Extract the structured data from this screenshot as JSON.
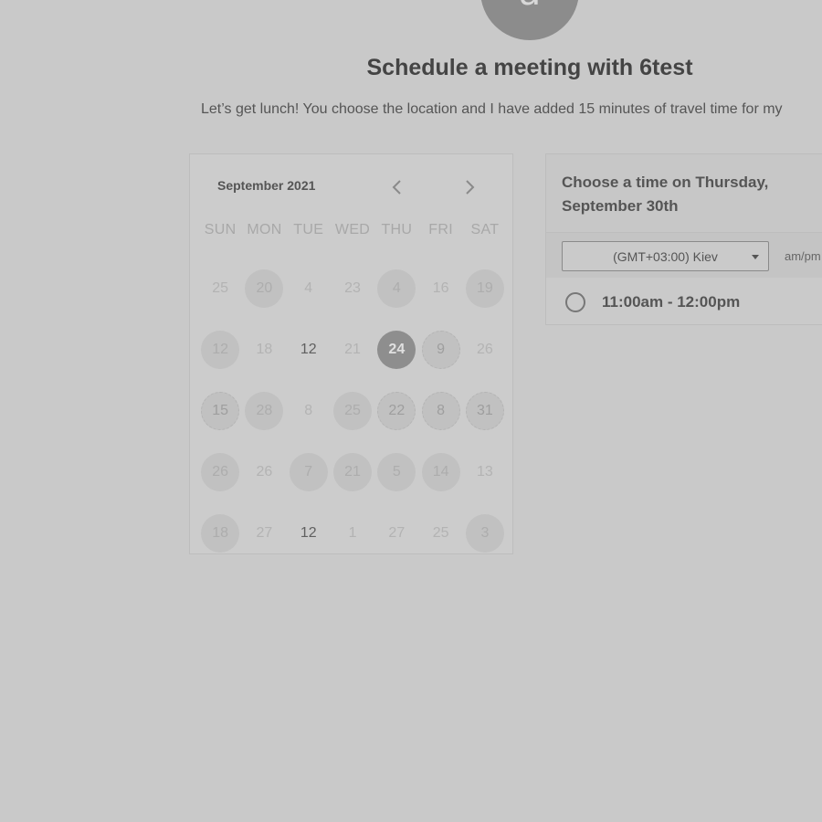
{
  "host": {
    "avatar_letter": "a",
    "title": "Schedule a meeting with 6test",
    "description": "Let’s get lunch! You choose the location and I have added 15 minutes of travel time for my"
  },
  "calendar": {
    "month_label": "September 2021",
    "prev_icon": "chevron-left-icon",
    "next_icon": "chevron-right-icon",
    "weekdays": [
      "SUN",
      "MON",
      "TUE",
      "WED",
      "THU",
      "FRI",
      "SAT"
    ],
    "weeks": [
      [
        {
          "d": "25",
          "s": "dim"
        },
        {
          "d": "20",
          "s": "avail"
        },
        {
          "d": "4",
          "s": "dim"
        },
        {
          "d": "23",
          "s": "dim"
        },
        {
          "d": "4",
          "s": "avail"
        },
        {
          "d": "16",
          "s": "dim"
        },
        {
          "d": "19",
          "s": "avail"
        }
      ],
      [
        {
          "d": "12",
          "s": "avail"
        },
        {
          "d": "18",
          "s": "dim"
        },
        {
          "d": "12",
          "s": "dark"
        },
        {
          "d": "21",
          "s": "dim"
        },
        {
          "d": "24",
          "s": "selected"
        },
        {
          "d": "9",
          "s": "dotted"
        },
        {
          "d": "26",
          "s": "dim"
        }
      ],
      [
        {
          "d": "15",
          "s": "dotted"
        },
        {
          "d": "28",
          "s": "avail"
        },
        {
          "d": "8",
          "s": "dim"
        },
        {
          "d": "25",
          "s": "avail"
        },
        {
          "d": "22",
          "s": "dotted"
        },
        {
          "d": "8",
          "s": "dotted"
        },
        {
          "d": "31",
          "s": "dotted"
        }
      ],
      [
        {
          "d": "26",
          "s": "avail"
        },
        {
          "d": "26",
          "s": "dim"
        },
        {
          "d": "7",
          "s": "avail"
        },
        {
          "d": "21",
          "s": "avail"
        },
        {
          "d": "5",
          "s": "avail"
        },
        {
          "d": "14",
          "s": "avail"
        },
        {
          "d": "13",
          "s": "dim"
        }
      ],
      [
        {
          "d": "18",
          "s": "avail"
        },
        {
          "d": "27",
          "s": "dim"
        },
        {
          "d": "12",
          "s": "dark"
        },
        {
          "d": "1",
          "s": "dim"
        },
        {
          "d": "27",
          "s": "dim"
        },
        {
          "d": "25",
          "s": "dim"
        },
        {
          "d": "3",
          "s": "avail"
        }
      ]
    ]
  },
  "times": {
    "heading": "Choose a time on Thursday, September 30th",
    "timezone": "(GMT+03:00) Kiev",
    "format_label": "am/pm",
    "slots": [
      {
        "label": "11:00am - 12:00pm",
        "selected": false
      }
    ]
  },
  "colors": {
    "background": "#c9c9c9",
    "selected_day": "#8e8e8e",
    "available_day": "#c1c1c1"
  }
}
